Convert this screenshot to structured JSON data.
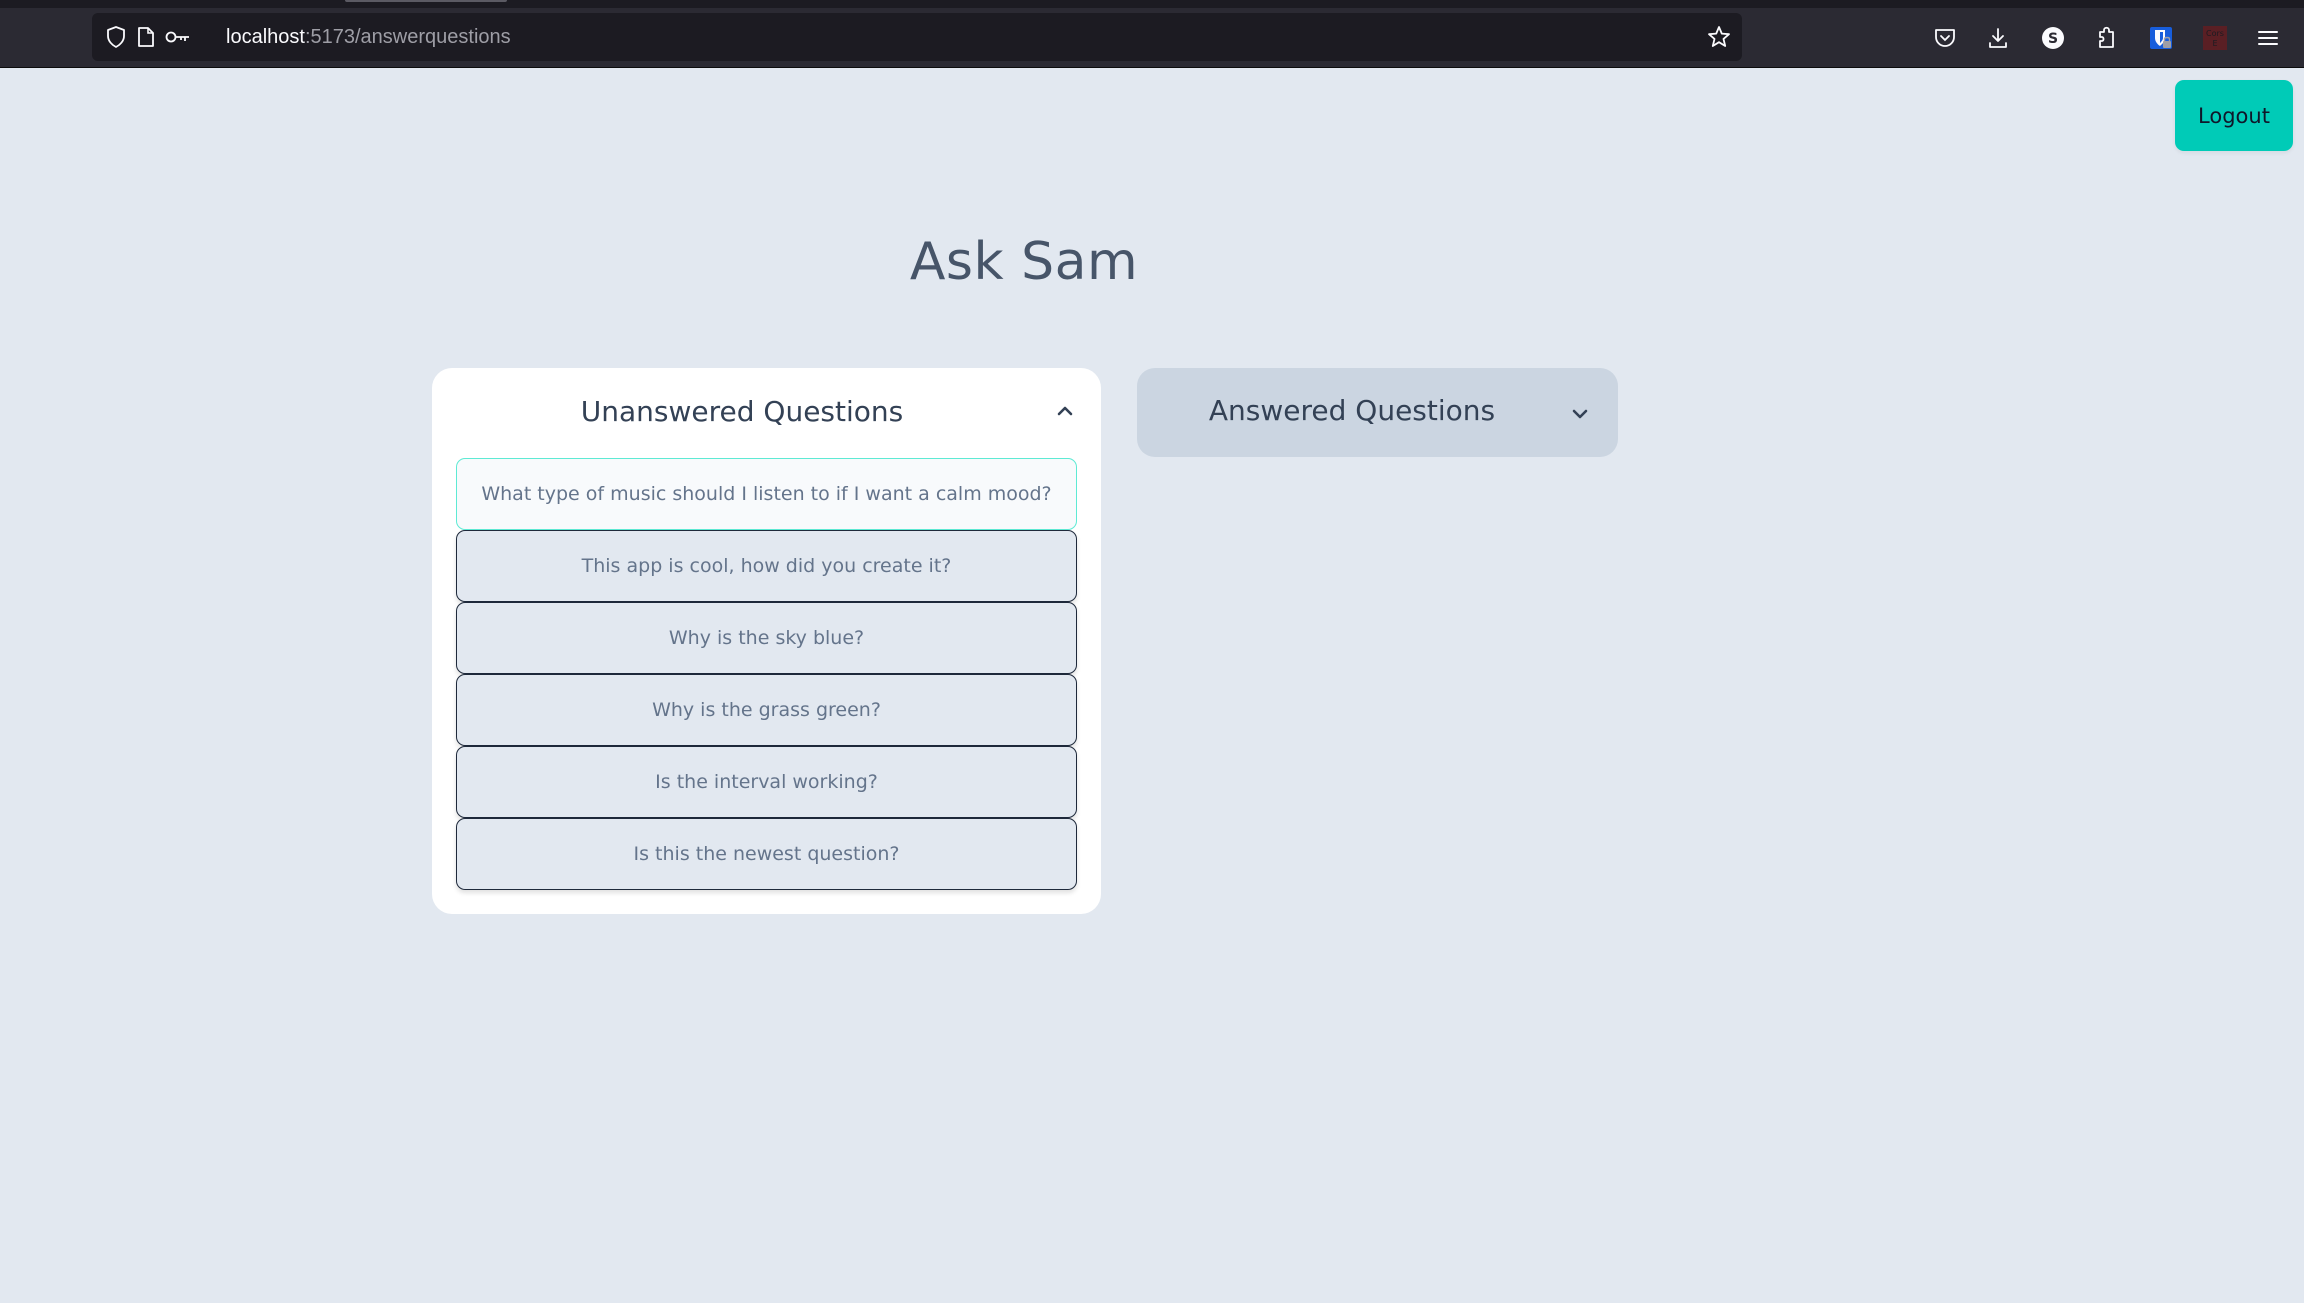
{
  "browser": {
    "url_host": "localhost",
    "url_rest": ":5173/answerquestions",
    "toolbar_icons": [
      "pocket-icon",
      "download-icon",
      "s-extension-icon",
      "extensions-puzzle-icon",
      "password-manager-icon",
      "cors-extension-icon",
      "menu-icon"
    ],
    "cors_extension_label_line1": "Cors",
    "cors_extension_label_line2": "E",
    "s_extension_letter": "S"
  },
  "header": {
    "logout_label": "Logout",
    "title": "Ask Sam"
  },
  "unanswered": {
    "title": "Unanswered Questions",
    "expanded": true,
    "questions": [
      "What type of music should I listen to if I want a calm mood?",
      "This app is cool, how did you create it?",
      "Why is the sky blue?",
      "Why is the grass green?",
      "Is the interval working?",
      "Is this the newest question?"
    ]
  },
  "answered": {
    "title": "Answered Questions",
    "expanded": false
  },
  "colors": {
    "accent": "#00cbb7",
    "page_background": "#e2e8f0",
    "selected_border": "#5eead4"
  }
}
